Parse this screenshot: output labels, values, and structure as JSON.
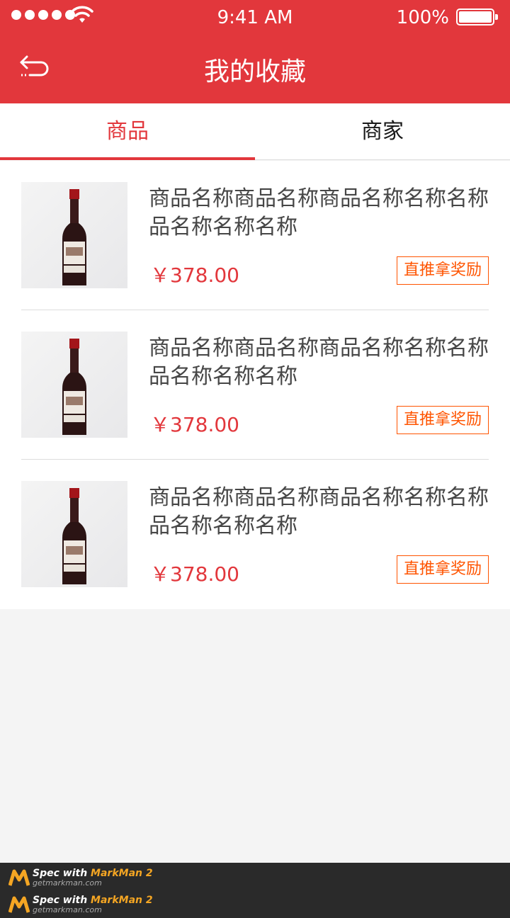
{
  "status_bar": {
    "time": "9:41 AM",
    "battery_text": "100%"
  },
  "header": {
    "title": "我的收藏",
    "back_icon": "back-arrow-icon",
    "bg_color": "#e2373c"
  },
  "tabs": [
    {
      "label": "商品",
      "active": true
    },
    {
      "label": "商家",
      "active": false
    }
  ],
  "items": [
    {
      "name": "商品名称商品名称商品名称名称名称品名称名称名称",
      "price": "￥378.00",
      "reward_label": "直推拿奖励"
    },
    {
      "name": "商品名称商品名称商品名称名称名称品名称名称名称",
      "price": "￥378.00",
      "reward_label": "直推拿奖励"
    },
    {
      "name": "商品名称商品名称商品名称名称名称品名称名称名称",
      "price": "￥378.00",
      "reward_label": "直推拿奖励"
    }
  ],
  "colors": {
    "accent": "#e2373c",
    "reward": "#ff5400",
    "name_text": "#464646",
    "tab_text": "#191919"
  },
  "footer": {
    "rows": [
      {
        "prefix": "Spec with ",
        "brand": "MarkMan 2",
        "site": "getmarkman.com"
      },
      {
        "prefix": "Spec with ",
        "brand": "MarkMan 2",
        "site": "getmarkman.com"
      }
    ]
  }
}
